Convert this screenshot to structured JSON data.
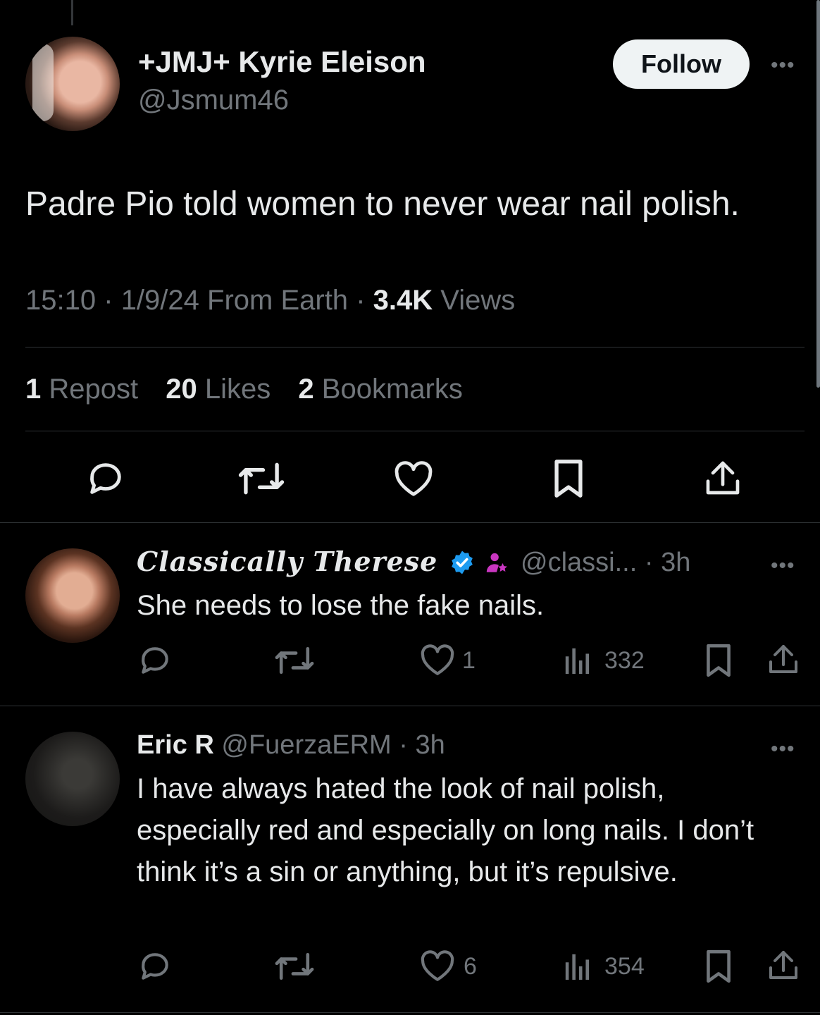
{
  "main_tweet": {
    "display_name": "+JMJ+ Kyrie Eleison",
    "handle": "@Jsmum46",
    "follow_label": "Follow",
    "text": "Padre Pio told women to never wear nail polish.",
    "time": "15:10",
    "date": "1/9/24 From Earth",
    "views_count": "3.4K",
    "views_label": "Views",
    "reposts_count": "1",
    "reposts_label": "Repost",
    "likes_count": "20",
    "likes_label": "Likes",
    "bookmarks_count": "2",
    "bookmarks_label": "Bookmarks"
  },
  "replies": [
    {
      "display_name": "Classically Therese",
      "handle": "@classi...",
      "time": "3h",
      "text": "She needs to lose the fake nails.",
      "likes": "1",
      "views": "332"
    },
    {
      "display_name": "Eric R",
      "handle": "@FuerzaERM",
      "time": "3h",
      "text": "I have always hated the look of nail polish, especially red and especially on long nails. I don’t think it’s a sin or anything, but it’s repulsive.",
      "likes": "6",
      "views": "354"
    }
  ],
  "separator": "·",
  "more_glyph": "•••",
  "colors": {
    "background": "#000000",
    "text": "#e7e9ea",
    "muted": "#71767b",
    "verified": "#1d9bf0",
    "badge": "#c936c0"
  }
}
